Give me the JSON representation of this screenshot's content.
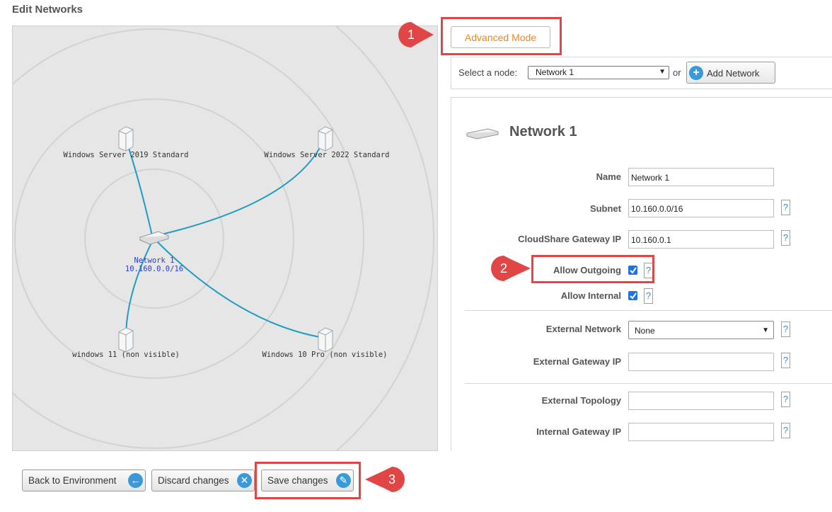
{
  "page": {
    "title": "Edit Networks"
  },
  "canvas": {
    "nodes": [
      {
        "id": "ws2019",
        "label": "Windows Server 2019 Standard"
      },
      {
        "id": "ws2022",
        "label": "Windows Server 2022 Standard"
      },
      {
        "id": "win11",
        "label": "windows 11 (non visible)"
      },
      {
        "id": "win10",
        "label": "Windows 10 Pro (non visible)"
      }
    ],
    "network": {
      "name": "Network 1",
      "subnet": "10.160.0.0/16"
    }
  },
  "toolbar": {
    "advanced_mode_label": "Advanced Mode",
    "select_node_label": "Select a node:",
    "select_node_value": "Network 1",
    "or_label": "or",
    "add_network_label": "Add Network"
  },
  "network_panel": {
    "title": "Network 1",
    "fields": {
      "name": {
        "label": "Name",
        "value": "Network 1"
      },
      "subnet": {
        "label": "Subnet",
        "value": "10.160.0.0/16"
      },
      "gateway_ip": {
        "label": "CloudShare Gateway IP",
        "value": "10.160.0.1"
      },
      "allow_outgoing": {
        "label": "Allow Outgoing",
        "checked": true
      },
      "allow_internal": {
        "label": "Allow Internal",
        "checked": true
      },
      "external_network": {
        "label": "External Network",
        "value": "None"
      },
      "external_gateway_ip": {
        "label": "External Gateway IP",
        "value": ""
      },
      "external_topology": {
        "label": "External Topology",
        "value": ""
      },
      "internal_gateway_ip": {
        "label": "Internal Gateway IP",
        "value": ""
      }
    },
    "help_glyph": "?"
  },
  "footer": {
    "back_label": "Back to Environment",
    "discard_label": "Discard changes",
    "save_label": "Save changes"
  },
  "callouts": {
    "one": "1",
    "two": "2",
    "three": "3"
  },
  "colors": {
    "callout": "#e04646",
    "link_line": "#1f9cc3",
    "accent_orange": "#e8872c",
    "icon_blue": "#3a9ad9"
  }
}
